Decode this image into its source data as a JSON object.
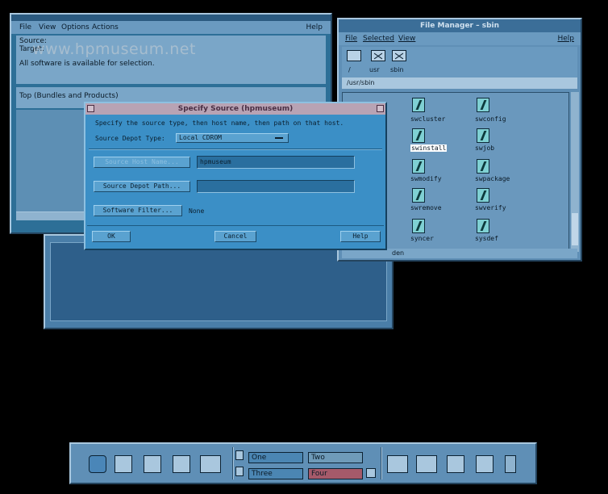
{
  "watermark": "www.hpmuseum.net",
  "sd_window": {
    "menu": [
      "File",
      "View",
      "Options",
      "Actions"
    ],
    "help": "Help",
    "source_label": "Source:",
    "target_label": "Target:",
    "availability": "All software is available for selection.",
    "list_header": "Top (Bundles and Products)"
  },
  "file_manager": {
    "title": "File Manager – sbin",
    "menu": [
      "File",
      "Selected",
      "View"
    ],
    "help": "Help",
    "path_folders": [
      "/",
      "usr",
      "sbin"
    ],
    "path": "/usr/sbin",
    "files": [
      "swcluster",
      "swconfig",
      "swinstall",
      "swjob",
      "swmodify",
      "swpackage",
      "swremove",
      "swverify",
      "syncer",
      "sysdef"
    ],
    "selected_file": "swinstall",
    "status_fragment": "den"
  },
  "dialog": {
    "title": "Specify Source (hpmuseum)",
    "instruction": "Specify the source type, then host name, then path on that host.",
    "depot_type_label": "Source Depot Type:",
    "depot_type_value": "Local CDROM",
    "host_name_button": "Source Host Name...",
    "host_name_value": "hpmuseum",
    "depot_path_button": "Source Depot Path...",
    "depot_path_value": "",
    "filter_button": "Software Filter...",
    "filter_value": "None",
    "ok": "OK",
    "cancel": "Cancel",
    "help": "Help"
  },
  "front_panel": {
    "workspaces": [
      "One",
      "Two",
      "Three",
      "Four"
    ],
    "workspace_colors": [
      "#4b86b3",
      "#6f9bb9",
      "#4b86b3",
      "#a55a6a"
    ],
    "active_workspace": "One"
  }
}
